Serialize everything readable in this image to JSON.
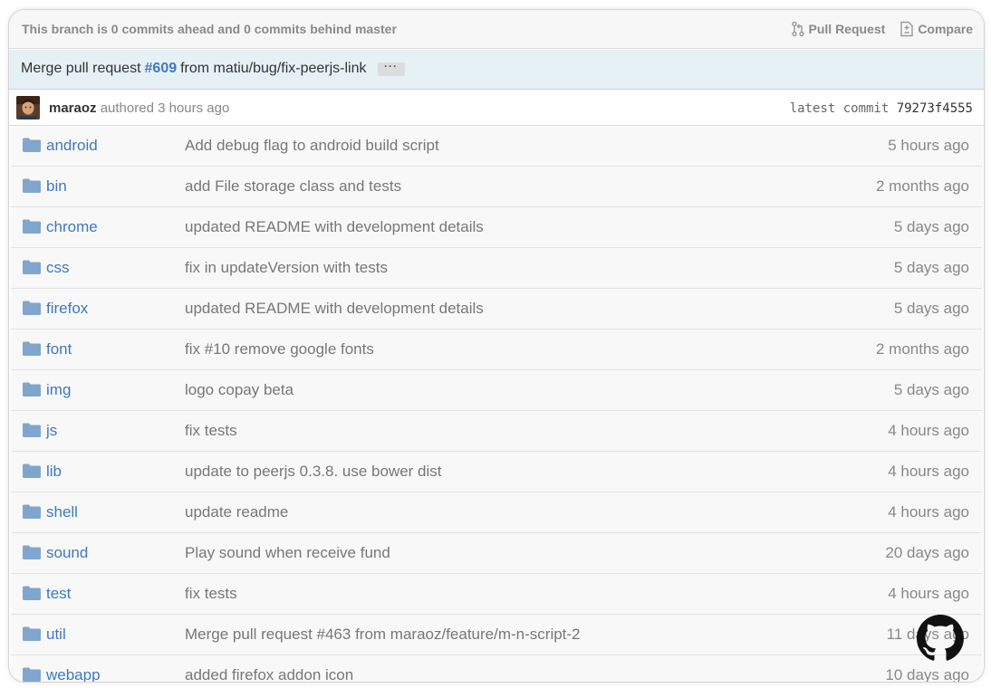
{
  "branch_bar": {
    "status": "This branch is 0 commits ahead and 0 commits behind master",
    "pull_request_label": "Pull Request",
    "compare_label": "Compare"
  },
  "commit_banner": {
    "prefix": "Merge pull request",
    "pr_number": "#609",
    "suffix": "from matiu/bug/fix-peerjs-link",
    "ellipsis": "···"
  },
  "author_bar": {
    "author": "maraoz",
    "authored_text": "authored 3 hours ago",
    "latest_commit_label": "latest commit",
    "sha": "79273f4555"
  },
  "files": [
    {
      "name": "android",
      "message": "Add debug flag to android build script",
      "age": "5 hours ago"
    },
    {
      "name": "bin",
      "message": "add File storage class and tests",
      "age": "2 months ago"
    },
    {
      "name": "chrome",
      "message": "updated README with development details",
      "age": "5 days ago"
    },
    {
      "name": "css",
      "message": "fix in updateVersion with tests",
      "age": "5 days ago"
    },
    {
      "name": "firefox",
      "message": "updated README with development details",
      "age": "5 days ago"
    },
    {
      "name": "font",
      "message": "fix #10 remove google fonts",
      "age": "2 months ago"
    },
    {
      "name": "img",
      "message": "logo copay beta",
      "age": "5 days ago"
    },
    {
      "name": "js",
      "message": "fix tests",
      "age": "4 hours ago"
    },
    {
      "name": "lib",
      "message": "update to peerjs 0.3.8. use bower dist",
      "age": "4 hours ago"
    },
    {
      "name": "shell",
      "message": "update readme",
      "age": "4 hours ago"
    },
    {
      "name": "sound",
      "message": "Play sound when receive fund",
      "age": "20 days ago"
    },
    {
      "name": "test",
      "message": "fix tests",
      "age": "4 hours ago"
    },
    {
      "name": "util",
      "message": "Merge pull request #463 from maraoz/feature/m-n-script-2",
      "age": "11 days ago"
    },
    {
      "name": "webapp",
      "message": "added firefox addon icon",
      "age": "10 days ago"
    }
  ],
  "icons": {
    "folder": "folder-icon",
    "pull_request": "git-pull-request-icon",
    "compare": "diff-icon",
    "brand": "github-octocat-icon"
  },
  "colors": {
    "link": "#4078c0",
    "folder": "#80a6cd",
    "banner": "#e6f1f6"
  }
}
